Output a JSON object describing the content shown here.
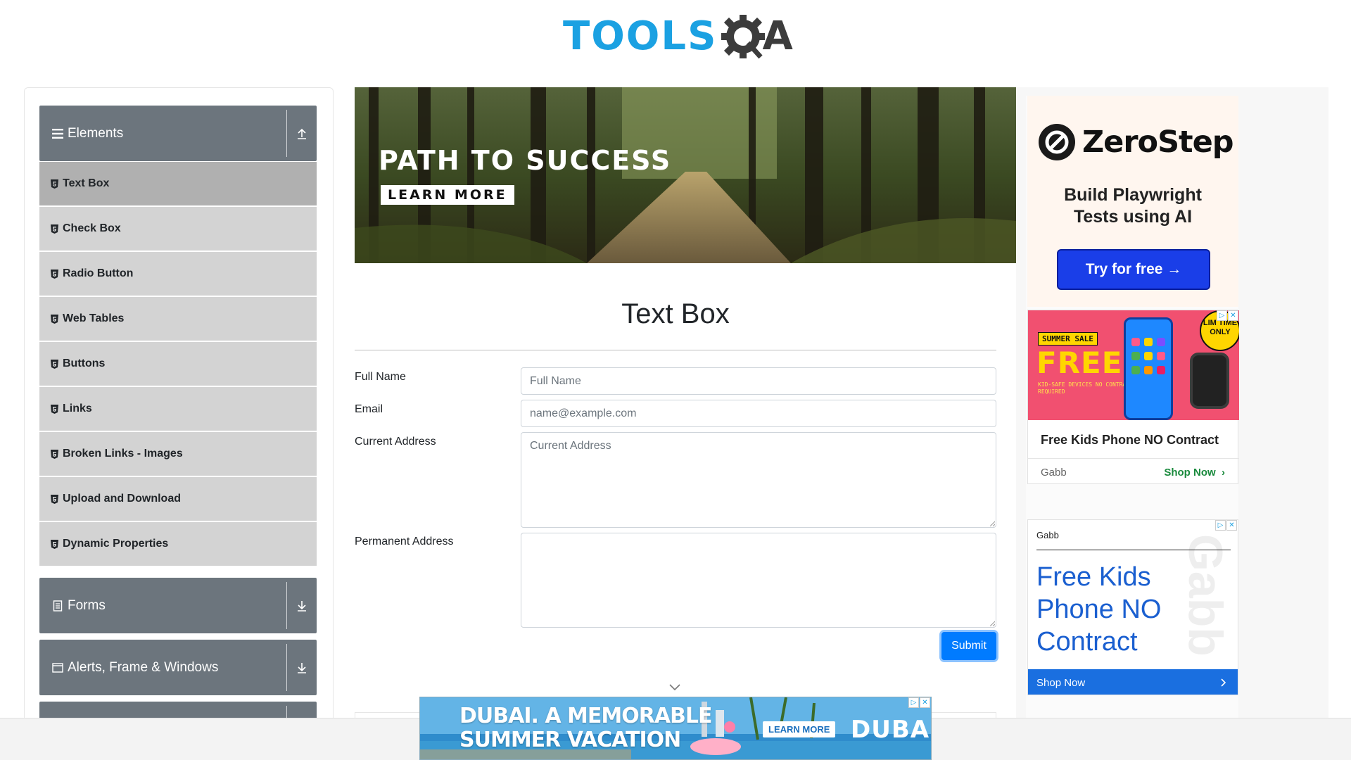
{
  "header": {
    "logo_tools": "TOOLS",
    "logo_a": "A",
    "brand_color": "#1ba1e2"
  },
  "sidebar": {
    "groups": [
      {
        "label": "Elements",
        "icon": "hamburger-icon",
        "state": "expanded"
      },
      {
        "label": "Forms",
        "icon": "document-icon",
        "state": "collapsed"
      },
      {
        "label": "Alerts, Frame & Windows",
        "icon": "window-icon",
        "state": "collapsed"
      }
    ],
    "items": [
      {
        "label": "Text Box",
        "active": true
      },
      {
        "label": "Check Box"
      },
      {
        "label": "Radio Button"
      },
      {
        "label": "Web Tables"
      },
      {
        "label": "Buttons"
      },
      {
        "label": "Links"
      },
      {
        "label": "Broken Links - Images"
      },
      {
        "label": "Upload and Download"
      },
      {
        "label": "Dynamic Properties"
      }
    ]
  },
  "banner": {
    "title": "PATH TO SUCCESS",
    "button": "LEARN MORE"
  },
  "main": {
    "title": "Text Box",
    "fields": {
      "full_name_label": "Full Name",
      "full_name_placeholder": "Full Name",
      "email_label": "Email",
      "email_placeholder": "name@example.com",
      "current_address_label": "Current Address",
      "current_address_placeholder": "Current Address",
      "permanent_address_label": "Permanent Address"
    },
    "submit": "Submit"
  },
  "ads": {
    "zerostep": {
      "name": "ZeroStep",
      "tagline_1": "Build Playwright",
      "tagline_2": "Tests using AI",
      "cta": "Try for free →"
    },
    "gabb_1": {
      "sale": "SUMMER SALE",
      "free": "FREE",
      "fine_print": "KID-SAFE DEVICES NO CONTRACT REQUIRED",
      "limited": "LIM TIME ONLY",
      "title": "Free Kids Phone NO Contract",
      "brand": "Gabb",
      "cta": "Shop Now"
    },
    "gabb_2": {
      "brand": "Gabb",
      "headline": "Free Kids Phone NO Contract",
      "watermark": "Gabb",
      "cta": "Shop Now"
    },
    "sticky": {
      "line_1": "DUBAI. A MEMORABLE",
      "line_2": "SUMMER VACATION",
      "cta": "LEARN MORE",
      "logo": "DUBAI"
    }
  }
}
